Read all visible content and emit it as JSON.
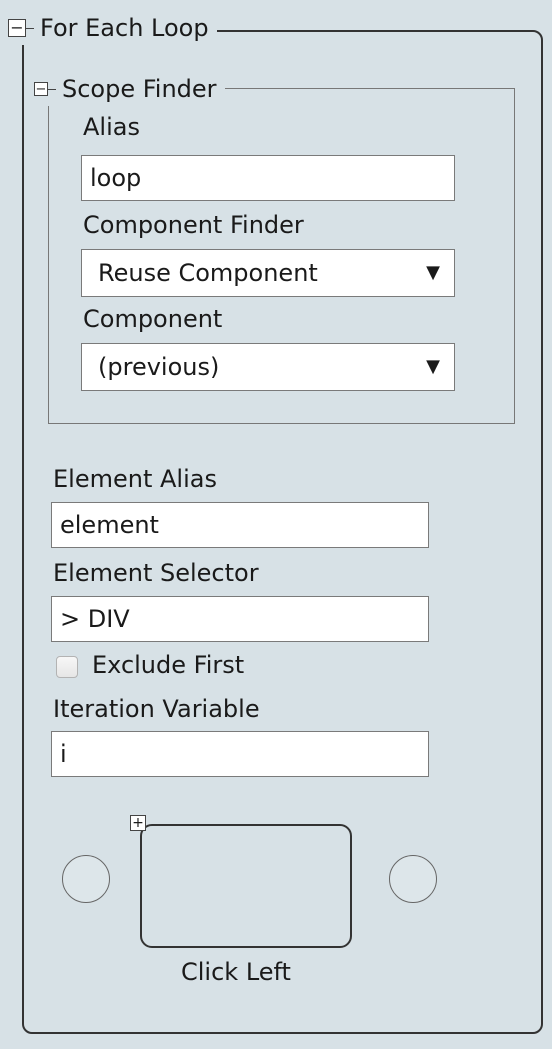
{
  "loop": {
    "title": "For Each Loop",
    "collapse_glyph": "−"
  },
  "scope_finder": {
    "title": "Scope Finder",
    "collapse_glyph": "−",
    "alias_label": "Alias",
    "alias_value": "loop",
    "component_finder_label": "Component Finder",
    "component_finder_value": "Reuse Component",
    "component_label": "Component",
    "component_value": "(previous)",
    "dropdown_arrow": "▼"
  },
  "element": {
    "alias_label": "Element Alias",
    "alias_value": "element",
    "selector_label": "Element Selector",
    "selector_value": "> DIV",
    "exclude_first_label": "Exclude First",
    "exclude_first_checked": false,
    "iteration_variable_label": "Iteration Variable",
    "iteration_variable_value": "i"
  },
  "child_action": {
    "expand_glyph": "+",
    "label": "Click Left"
  }
}
